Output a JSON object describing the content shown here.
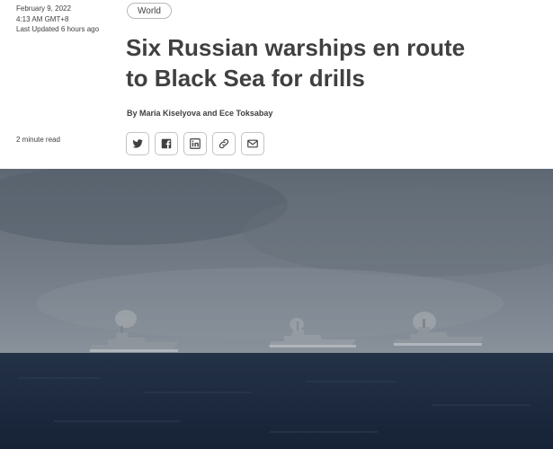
{
  "article": {
    "date": "February 9, 2022",
    "time": "4:13 AM GMT+8",
    "last_updated": "Last Updated 6 hours ago",
    "read_time": "2 minute read",
    "section_tag": "World",
    "headline_line1": "Six Russian warships en route",
    "headline_line2": "to Black Sea for drills",
    "byline": "By Maria Kiselyova and Ece Toksabay"
  },
  "share": {
    "icons": [
      "twitter-icon",
      "facebook-icon",
      "linkedin-icon",
      "link-icon",
      "email-icon"
    ]
  },
  "photo": {
    "subject": "three warships at sea under overcast sky",
    "colors": {
      "sky": "#6c7580",
      "sea": "#1b2a3e",
      "ship": "#9aa0a8"
    }
  }
}
